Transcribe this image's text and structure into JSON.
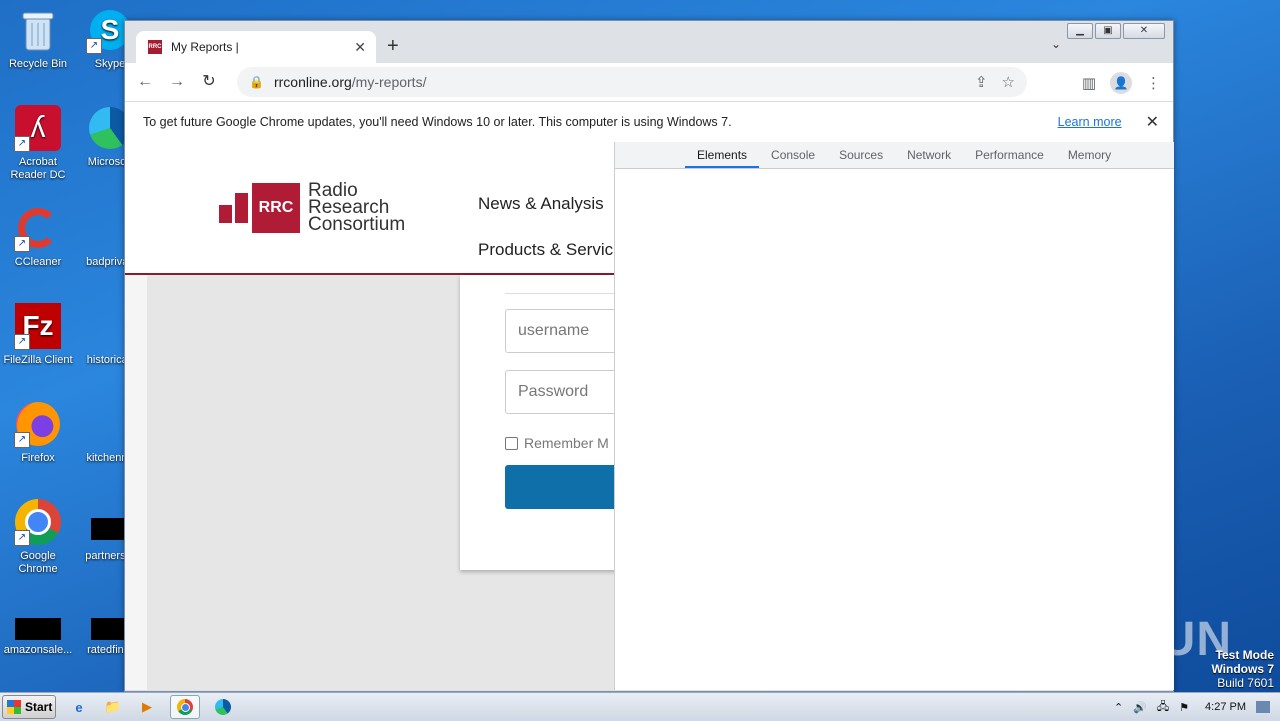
{
  "desktop": {
    "col1": [
      {
        "label": "Recycle Bin",
        "icon": "recycle-bin-icon"
      },
      {
        "label": "Acrobat Reader DC",
        "icon": "acrobat-icon"
      },
      {
        "label": "CCleaner",
        "icon": "ccleaner-icon"
      },
      {
        "label": "FileZilla Client",
        "icon": "filezilla-icon"
      },
      {
        "label": "Firefox",
        "icon": "firefox-icon"
      },
      {
        "label": "Google Chrome",
        "icon": "chrome-icon"
      },
      {
        "label": "amazonsale...",
        "icon": "file-icon"
      }
    ],
    "col2": [
      {
        "label": "Skype",
        "icon": "skype-icon"
      },
      {
        "label": "Microsoft",
        "icon": "edge-icon"
      },
      {
        "label": "badprivac",
        "icon": "file-icon"
      },
      {
        "label": "historicalf",
        "icon": "file-icon"
      },
      {
        "label": "kitchenna",
        "icon": "file-icon"
      },
      {
        "label": "partnersm",
        "icon": "file-icon"
      },
      {
        "label": "ratedfinat",
        "icon": "file-icon"
      }
    ],
    "watermark": "ANY RUN",
    "test_mode": [
      "Test Mode",
      "Windows 7",
      "Build 7601"
    ]
  },
  "browser": {
    "tab_title": "My Reports |",
    "favicon_text": "RRC",
    "url_host": "rrconline.org",
    "url_path": "/my-reports/",
    "infobar": {
      "message": "To get future Google Chrome updates, you'll need Windows 10 or later. This computer is using Windows 7.",
      "link": "Learn more"
    }
  },
  "page": {
    "logo_mark": "RRC",
    "logo_text": [
      "Radio",
      "Research",
      "Consortium"
    ],
    "nav": [
      "News & Analysis",
      "Products & Servic"
    ],
    "login": {
      "username_placeholder": "username",
      "password_placeholder": "Password",
      "remember_label": "Remember M"
    }
  },
  "devtools": {
    "tabs": [
      "Elements",
      "Console",
      "Sources",
      "Network",
      "Performance",
      "Memory"
    ],
    "active_tab": "Elements"
  },
  "taskbar": {
    "start_label": "Start",
    "clock": "4:27 PM"
  }
}
